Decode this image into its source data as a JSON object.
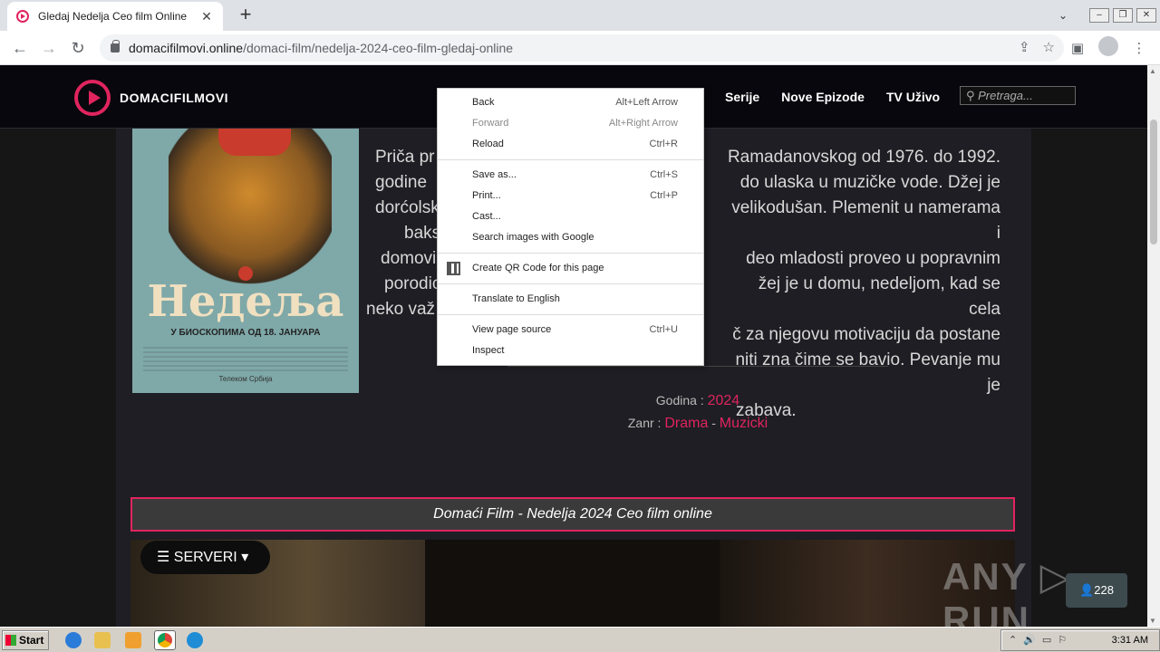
{
  "browser": {
    "tab_title": "Gledaj Nedelja Ceo film Online",
    "tab_close": "✕",
    "new_tab": "+",
    "url_host": "domacifilmovi.online",
    "url_path": "/domaci-film/nedelja-2024-ceo-film-gledaj-online"
  },
  "site": {
    "logo": "DOMACIFILMOVI",
    "nav": [
      "Serije",
      "Nove Epizode",
      "TV Uživo"
    ],
    "search_placeholder": "Pretraga..."
  },
  "movie": {
    "poster_title": "Недеља",
    "poster_subtitle": "У БИОСКОПИМА ОД 18. ЈАНУАРА",
    "poster_footer": "Телеком Србија",
    "description_lines": [
      "Priča pr",
      "godine",
      "dorćolsk",
      "baks",
      "domovi",
      "porodic",
      "neko važ",
      "",
      "Ramadanovskog od 1976. do 1992.",
      "do ulaska u muzičke vode. Džej je",
      "velikodušan. Plemenit u namerama i",
      "deo mladosti proveo u popravnim",
      "žej je u domu, nedeljom, kad se cela",
      "č za njegovu motivaciju da postane",
      "niti zna čime se bavio. Pevanje mu je",
      "zabava."
    ],
    "year_label": "Godina :",
    "year": "2024",
    "genre_label": "Zanr :",
    "genre1": "Drama",
    "genre_sep": "-",
    "genre2": "Muzicki",
    "title_bar": "Domaći Film - Nedelja 2024 Ceo film online",
    "servers": "☰ SERVERI ▾",
    "watermark": "ANY ▷ RUN",
    "viewers": "👤228"
  },
  "context_menu": {
    "items": [
      {
        "label": "Back",
        "shortcut": "Alt+Left Arrow"
      },
      {
        "label": "Forward",
        "shortcut": "Alt+Right Arrow"
      },
      {
        "label": "Reload",
        "shortcut": "Ctrl+R"
      },
      {
        "label": "Save as...",
        "shortcut": "Ctrl+S"
      },
      {
        "label": "Print...",
        "shortcut": "Ctrl+P"
      },
      {
        "label": "Cast...",
        "shortcut": ""
      },
      {
        "label": "Search images with Google",
        "shortcut": ""
      },
      {
        "label": "Create QR Code for this page",
        "shortcut": ""
      },
      {
        "label": "Translate to English",
        "shortcut": ""
      },
      {
        "label": "View page source",
        "shortcut": "Ctrl+U"
      },
      {
        "label": "Inspect",
        "shortcut": ""
      }
    ]
  },
  "taskbar": {
    "start": "Start",
    "time": "3:31 AM"
  },
  "colors": {
    "accent": "#e0245e"
  }
}
